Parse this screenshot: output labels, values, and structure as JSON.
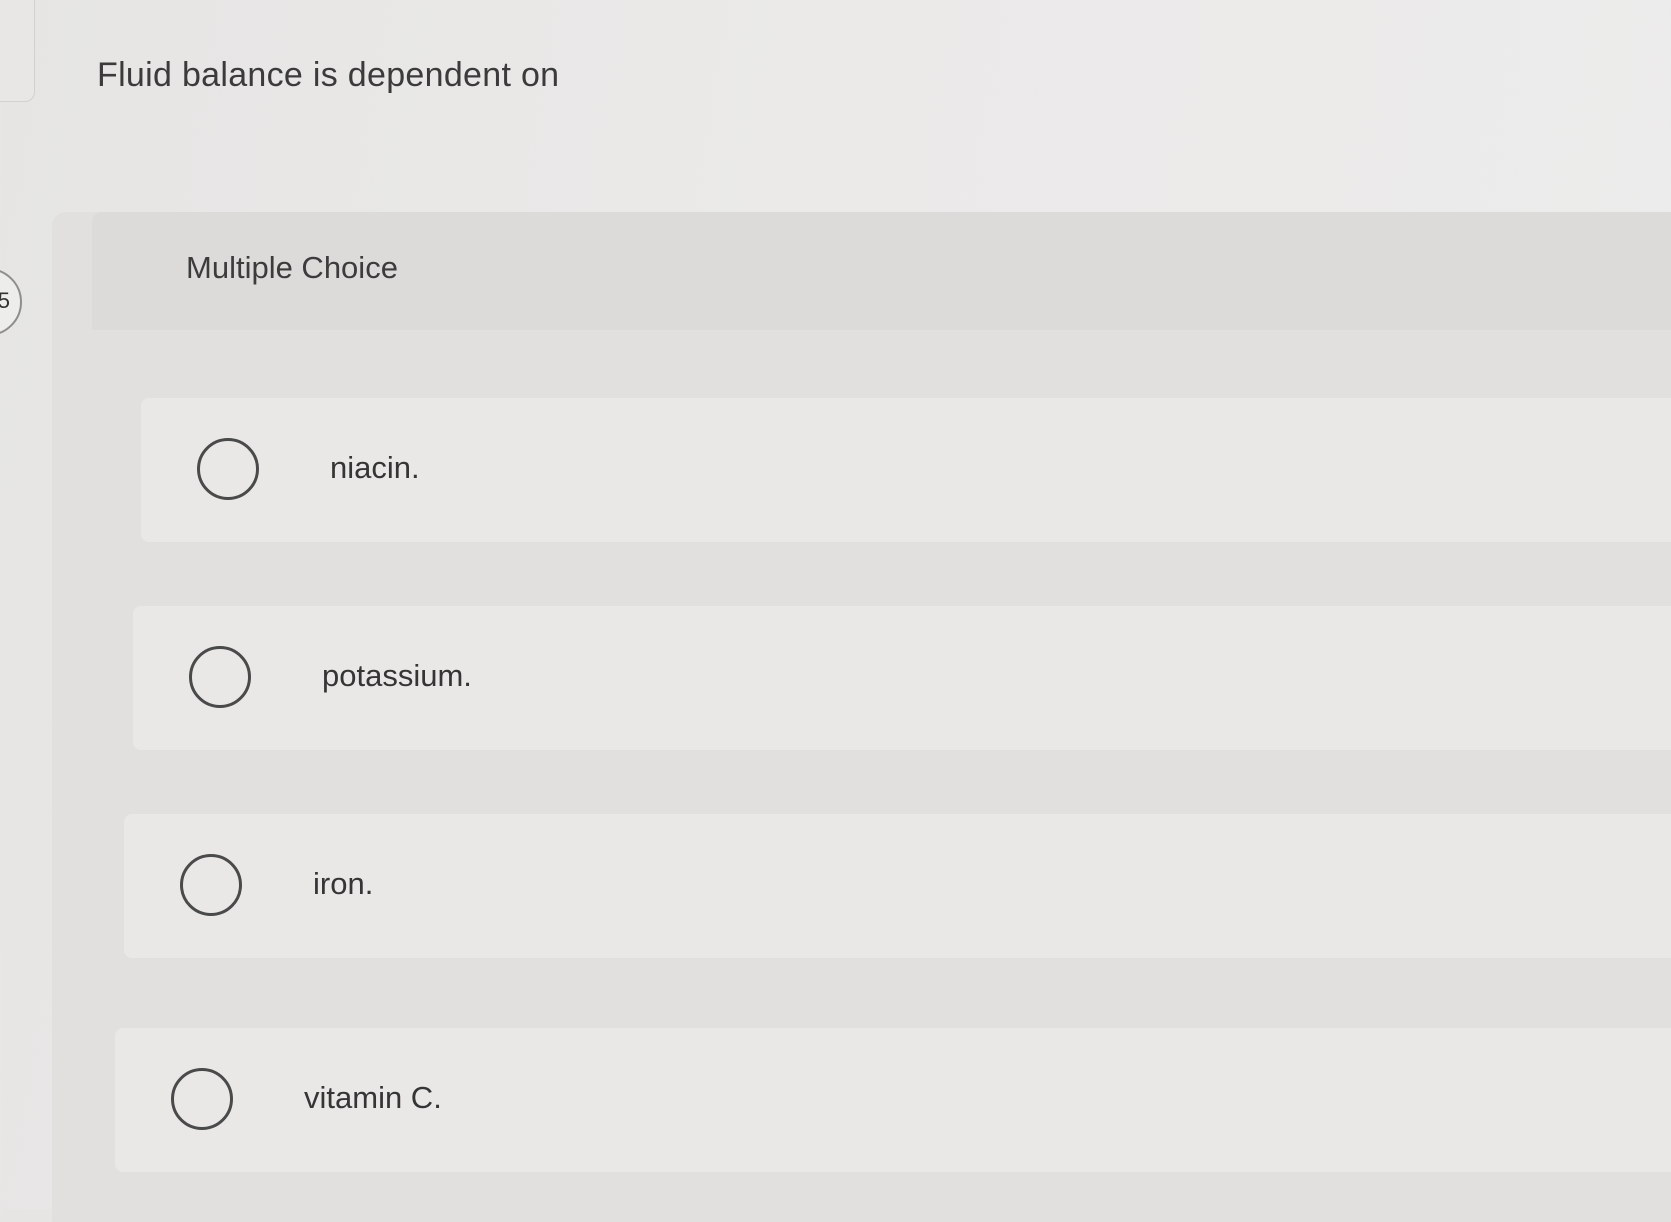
{
  "question": {
    "number": "5",
    "text": "Fluid balance is dependent on"
  },
  "answer_area": {
    "type_label": "Multiple Choice",
    "choices": [
      {
        "label": "niacin.",
        "selected": false
      },
      {
        "label": "potassium.",
        "selected": false
      },
      {
        "label": "iron.",
        "selected": false
      },
      {
        "label": "vitamin C.",
        "selected": false
      }
    ]
  }
}
